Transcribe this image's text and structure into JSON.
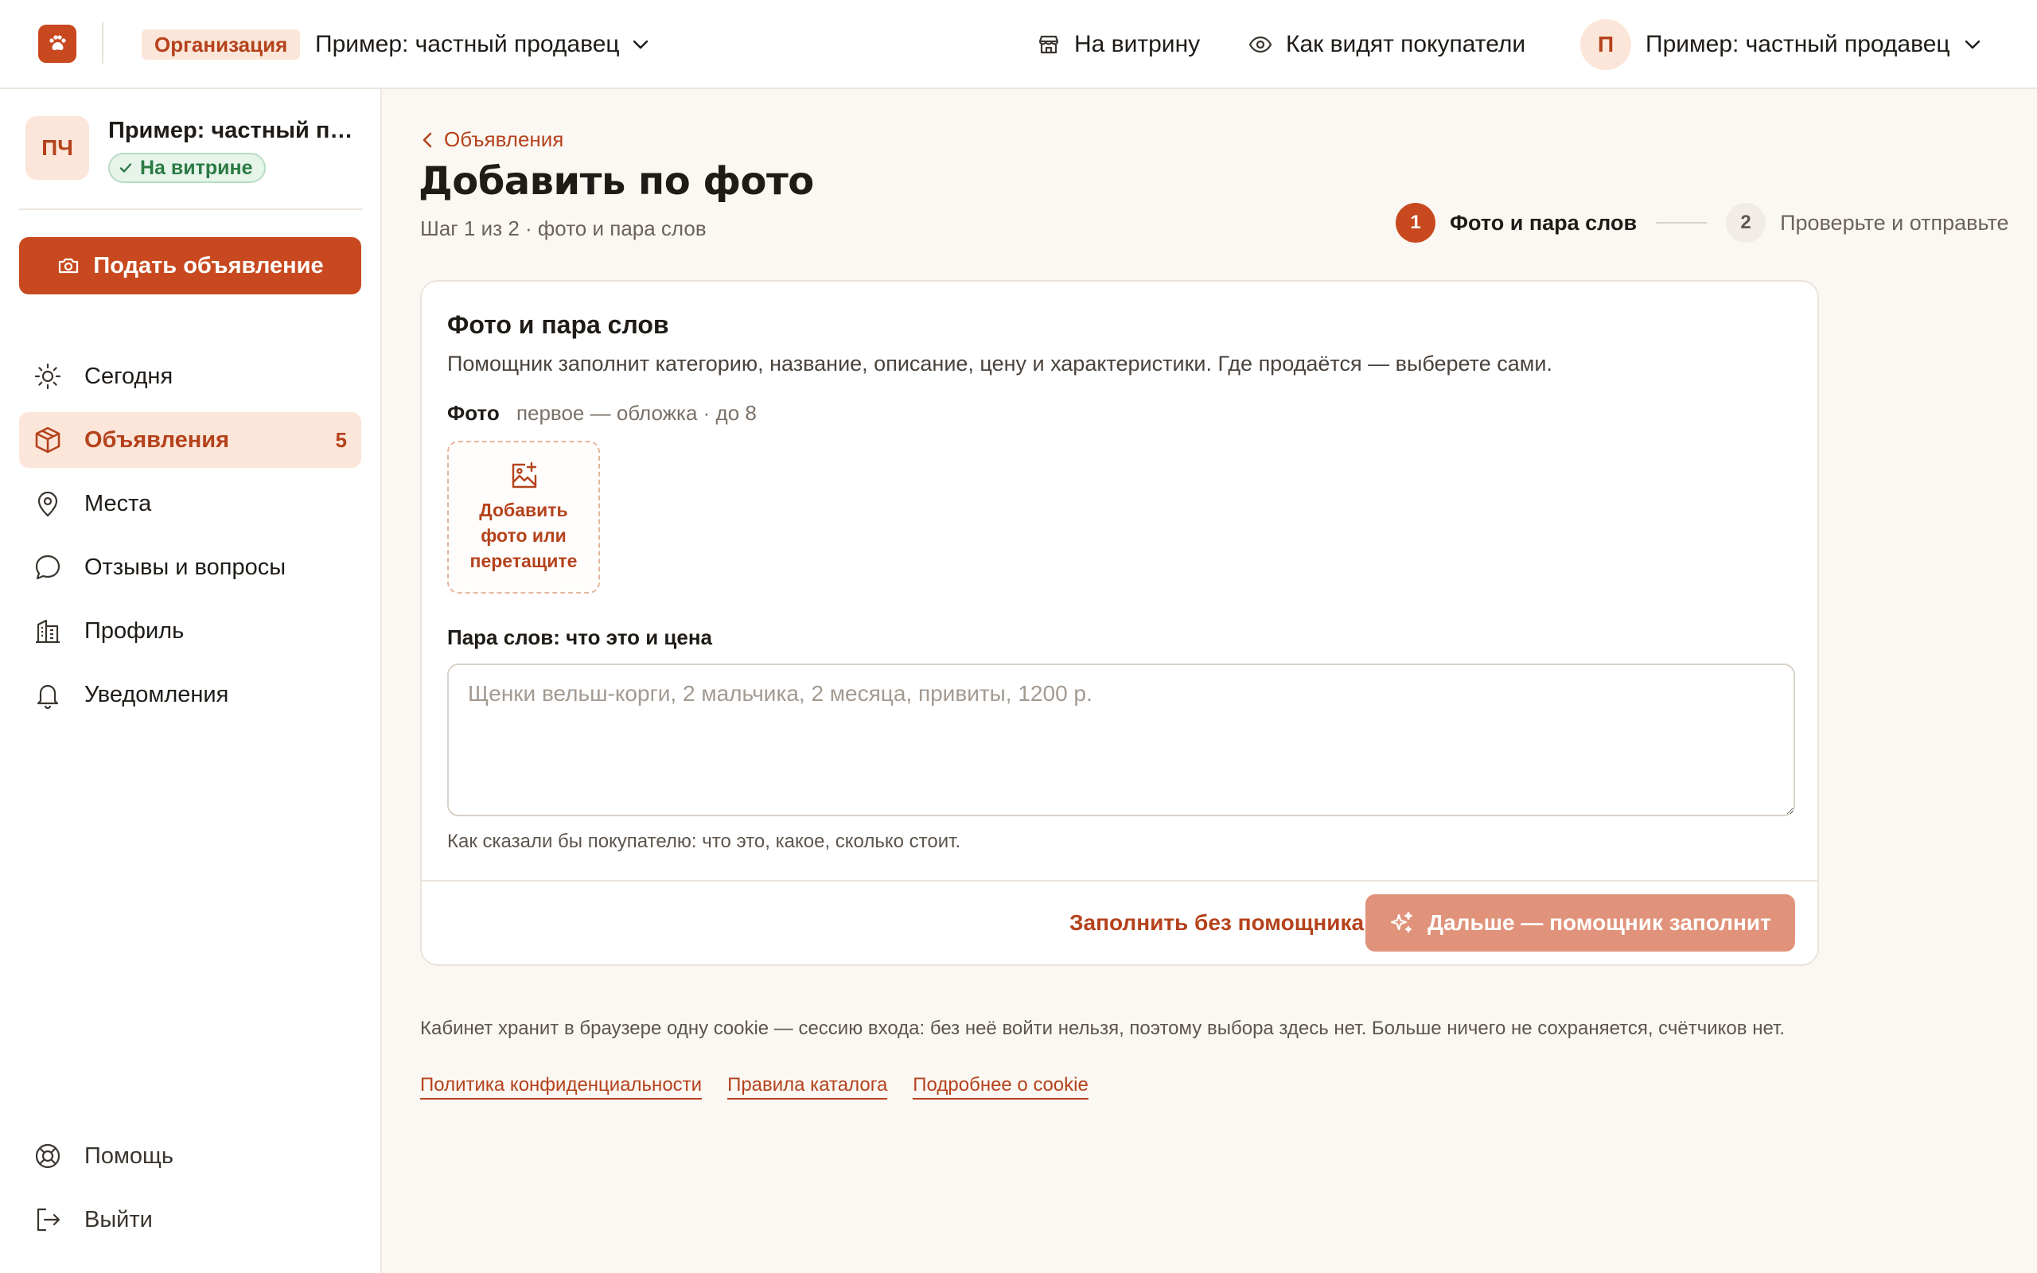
{
  "topbar": {
    "logo_icon": "paw-icon",
    "org_badge": "Организация",
    "org_name": "Пример: частный продавец",
    "storefront_link": "На витрину",
    "buyer_view_link": "Как видят покупатели",
    "user_initial": "П",
    "user_name": "Пример: частный продавец"
  },
  "sidebar": {
    "seller_initials": "ПЧ",
    "seller_name": "Пример: частный продавец",
    "seller_status": "На витрине",
    "post_button": "Подать объявление",
    "nav": [
      {
        "label": "Сегодня",
        "icon": "sun-icon"
      },
      {
        "label": "Объявления",
        "icon": "box-icon",
        "count": "5",
        "active": true
      },
      {
        "label": "Места",
        "icon": "map-pin-icon"
      },
      {
        "label": "Отзывы и вопросы",
        "icon": "chat-icon"
      },
      {
        "label": "Профиль",
        "icon": "building-icon"
      },
      {
        "label": "Уведомления",
        "icon": "bell-icon"
      }
    ],
    "bottom": [
      {
        "label": "Помощь",
        "icon": "lifebuoy-icon"
      },
      {
        "label": "Выйти",
        "icon": "logout-icon"
      }
    ]
  },
  "main": {
    "back_link": "Объявления",
    "title": "Добавить по фото",
    "subtitle": "Шаг 1 из 2 · фото и пара слов",
    "steps": [
      {
        "num": "1",
        "label": "Фото и пара слов",
        "active": true
      },
      {
        "num": "2",
        "label": "Проверьте и отправьте",
        "active": false
      }
    ],
    "card": {
      "title": "Фото и пара слов",
      "description": "Помощник заполнит категорию, название, описание, цену и характеристики. Где продаётся — выберете сами.",
      "photo_label": "Фото",
      "photo_hint": "первое — обложка · до 8",
      "upload_text": "Добавить\nфото или\nперетащите",
      "field_label": "Пара слов: что это и цена",
      "field_placeholder": "Щенки вельш-корги, 2 мальчика, 2 месяца, привиты, 1200 р.",
      "field_value": "",
      "field_hint": "Как сказали бы покупателю: что это, какое, сколько стоит.",
      "skip_button": "Заполнить без помощника",
      "next_button": "Дальше — помощник заполнит"
    },
    "cookie_notice": "Кабинет хранит в браузере одну cookie — сессию входа: без неё войти нельзя, поэтому выбора здесь нет. Больше ничего не сохраняется, счётчиков нет.",
    "footer_links": [
      "Политика конфиденциальности",
      "Правила каталога",
      "Подробнее о cookie"
    ]
  },
  "colors": {
    "accent": "#c8491f",
    "accent_text": "#b5421c",
    "accent_soft": "#fbe6d9",
    "next_button_disabled": "#e0937a",
    "success": "#2b7a44",
    "background": "#fbf8f3"
  }
}
